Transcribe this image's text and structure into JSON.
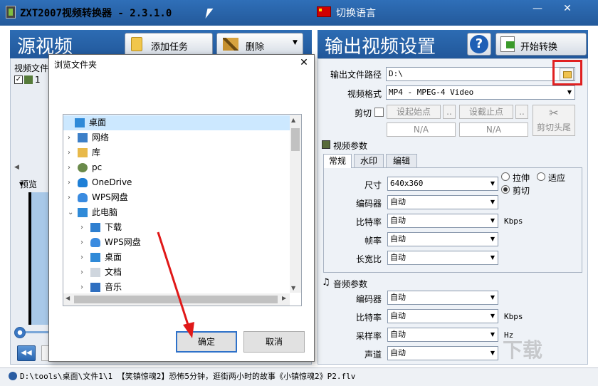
{
  "window": {
    "title": "ZXT2007视频转换器 - 2.3.1.0",
    "lang_switch": "切换语言",
    "minimize": "—",
    "close": "✕"
  },
  "source": {
    "title": "源视频",
    "add_task": "添加任务",
    "delete": "删除",
    "list_label": "视频文件",
    "row_number": "1",
    "preview_label": "预览"
  },
  "output": {
    "title": "输出视频设置",
    "help": "?",
    "start": "开始转换",
    "path_label": "输出文件路径",
    "path_value": "D:\\",
    "format_label": "视频格式",
    "format_value": "MP4 - MPEG-4 Video",
    "clip_label": "剪切",
    "set_start": "设起始点",
    "set_end": "设截止点",
    "more": "..",
    "start_value": "N/A",
    "end_value": "N/A",
    "cut_ends": "剪切头尾"
  },
  "video_params": {
    "section": "视频参数",
    "tabs": [
      "常规",
      "水印",
      "编辑"
    ],
    "size_label": "尺寸",
    "size_value": "640x360",
    "stretch": "拉伸",
    "fit": "适应",
    "crop": "剪切",
    "encoder_label": "编码器",
    "encoder_value": "自动",
    "bitrate_label": "比特率",
    "bitrate_value": "自动",
    "bitrate_unit": "Kbps",
    "framerate_label": "帧率",
    "framerate_value": "自动",
    "aspect_label": "长宽比",
    "aspect_value": "自动"
  },
  "audio_params": {
    "section": "音频参数",
    "encoder_label": "编码器",
    "encoder_value": "自动",
    "bitrate_label": "比特率",
    "bitrate_value": "自动",
    "bitrate_unit": "Kbps",
    "samplerate_label": "采样率",
    "samplerate_value": "自动",
    "samplerate_unit": "Hz",
    "channel_label": "声道",
    "channel_value": "自动"
  },
  "status": {
    "text": "D:\\tools\\桌面\\文件1\\1 【笑镇惊魂2】恐怖5分钟，逛街两小时的故事《小镇惊魂2》P2.flv"
  },
  "dialog": {
    "title": "浏览文件夹",
    "close": "✕",
    "ok": "确定",
    "cancel": "取消",
    "tree": [
      {
        "label": "桌面",
        "icon": "desktop-icon",
        "selected": true
      },
      {
        "label": "网络",
        "icon": "network-icon"
      },
      {
        "label": "库",
        "icon": "library-icon"
      },
      {
        "label": "pc",
        "icon": "user-icon"
      },
      {
        "label": "OneDrive",
        "icon": "cloud-icon"
      },
      {
        "label": "WPS网盘",
        "icon": "wps-cloud-icon"
      },
      {
        "label": "此电脑",
        "icon": "computer-icon",
        "expanded": true
      },
      {
        "label": "下载",
        "icon": "download-icon"
      },
      {
        "label": "WPS网盘",
        "icon": "wps-cloud-icon"
      },
      {
        "label": "桌面",
        "icon": "desktop-icon"
      },
      {
        "label": "文档",
        "icon": "document-icon"
      },
      {
        "label": "音乐",
        "icon": "music-icon"
      }
    ]
  },
  "watermark": "下载",
  "colors": {
    "header_blue": "#2d6cb3",
    "highlight_red": "#e02020",
    "selection": "#cce8ff"
  }
}
